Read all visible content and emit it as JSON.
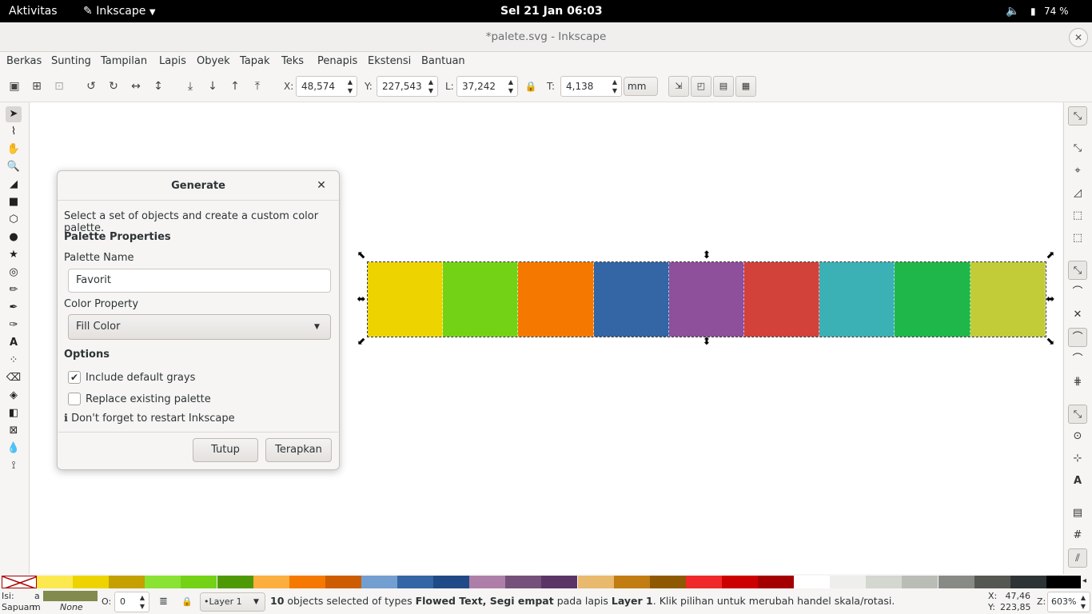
{
  "topbar": {
    "activities": "Aktivitas",
    "app_name": "Inkscape",
    "clock": "Sel 21 Jan  06:03",
    "battery": "74 %"
  },
  "window": {
    "title": "*palete.svg - Inkscape"
  },
  "menubar": [
    "Berkas",
    "Sunting",
    "Tampilan",
    "Lapis",
    "Obyek",
    "Tapak",
    "Teks",
    "Penapis",
    "Ekstensi",
    "Bantuan"
  ],
  "controls": {
    "x_label": "X:",
    "x_value": "48,574",
    "y_label": "Y:",
    "y_value": "227,543",
    "w_label": "L:",
    "w_value": "37,242",
    "h_label": "T:",
    "h_value": "4,138",
    "unit": "mm"
  },
  "dialog": {
    "title": "Generate",
    "description": "Select a set of objects and create a custom color palette.",
    "palette_properties_heading": "Palette Properties",
    "palette_name_label": "Palette Name",
    "palette_name_value": "Favorit",
    "color_property_label": "Color Property",
    "color_property_value": "Fill Color",
    "options_heading": "Options",
    "include_grays_label": "Include default grays",
    "include_grays_checked": true,
    "replace_palette_label": "Replace existing palette",
    "replace_palette_checked": false,
    "note": "ℹ Don't forget to restart Inkscape",
    "close_button": "Tutup",
    "apply_button": "Terapkan"
  },
  "canvas_swatches": [
    "#edd400",
    "#73d216",
    "#f57900",
    "#3465a4",
    "#8e4f9b",
    "#d3413b",
    "#3bb0b5",
    "#1fb74a",
    "#c2cc38"
  ],
  "palette_colors": [
    "#fce94f",
    "#edd400",
    "#c4a000",
    "#8ae234",
    "#73d216",
    "#4e9a06",
    "#fcaf3e",
    "#f57900",
    "#ce5c00",
    "#729fcf",
    "#3465a4",
    "#204a87",
    "#ad7fa8",
    "#75507b",
    "#5c3566",
    "#e9b96e",
    "#c17d11",
    "#8f5902",
    "#ef2929",
    "#cc0000",
    "#a40000",
    "#ffffff",
    "#eeeeec",
    "#d3d7cf",
    "#babdb6",
    "#888a85",
    "#555753",
    "#2e3436",
    "#000000"
  ],
  "status": {
    "fill_label": "Isi:",
    "fill_value": "a",
    "stroke_label": "Sapuan:",
    "stroke_value": "m",
    "stroke_none": "None",
    "opacity_label": "O:",
    "opacity_value": "0",
    "layer": "•Layer 1",
    "message_count": "10",
    "message_part1": " objects selected of types ",
    "message_types": "Flowed Text, Segi empat",
    "message_part2": " pada lapis ",
    "message_layer": "Layer 1",
    "message_part3": ". Klik pilihan untuk merubah handel skala/rotasi.",
    "cursor_x_label": "X:",
    "cursor_x": "47,46",
    "cursor_y_label": "Y:",
    "cursor_y": "223,85",
    "zoom_label": "Z:",
    "zoom_value": "603%"
  }
}
